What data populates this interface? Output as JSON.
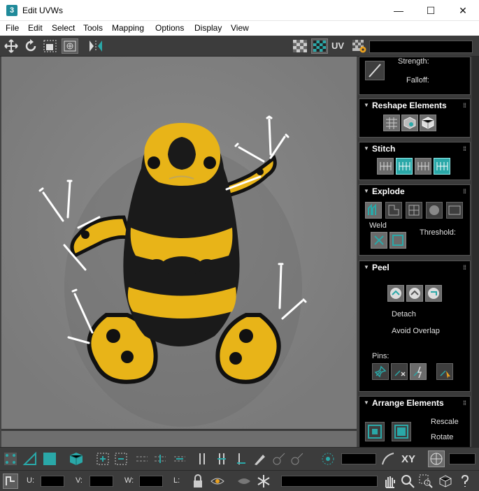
{
  "window": {
    "app_icon_text": "3",
    "title": "Edit UVWs",
    "minimize_glyph": "—",
    "maximize_glyph": "☐",
    "close_glyph": "✕"
  },
  "menu": [
    "File",
    "Edit",
    "Select",
    "Tools",
    "Mapping",
    "Options",
    "Display",
    "View"
  ],
  "toolbar": {
    "uv_label": "UV",
    "icons": [
      "move-icon",
      "rotate-icon",
      "scale-icon",
      "freeform-icon",
      "mirror-icon",
      "checker-icon",
      "checker-active-icon",
      "uv-settings-icon"
    ]
  },
  "panel": {
    "soft_selection": {
      "strength_label": "Strength:",
      "falloff_label": "Falloff:"
    },
    "reshape": {
      "title": "Reshape Elements"
    },
    "stitch": {
      "title": "Stitch"
    },
    "explode": {
      "title": "Explode",
      "weld_label": "Weld",
      "threshold_label": "Threshold:"
    },
    "peel": {
      "title": "Peel",
      "detach_label": "Detach",
      "avoid_overlap_label": "Avoid Overlap",
      "pins_label": "Pins:"
    },
    "arrange": {
      "title": "Arrange Elements",
      "rescale_label": "Rescale",
      "rotate_label": "Rotate"
    }
  },
  "bottom": {
    "xy_label": "XY",
    "u_label": "U:",
    "v_label": "V:",
    "w_label": "W:",
    "l_label": "L:"
  },
  "colors": {
    "accent_teal": "#2aa8a8",
    "frog_yellow": "#e8b418",
    "frog_black": "#1a1a1a",
    "viewport_gray": "#828282"
  }
}
